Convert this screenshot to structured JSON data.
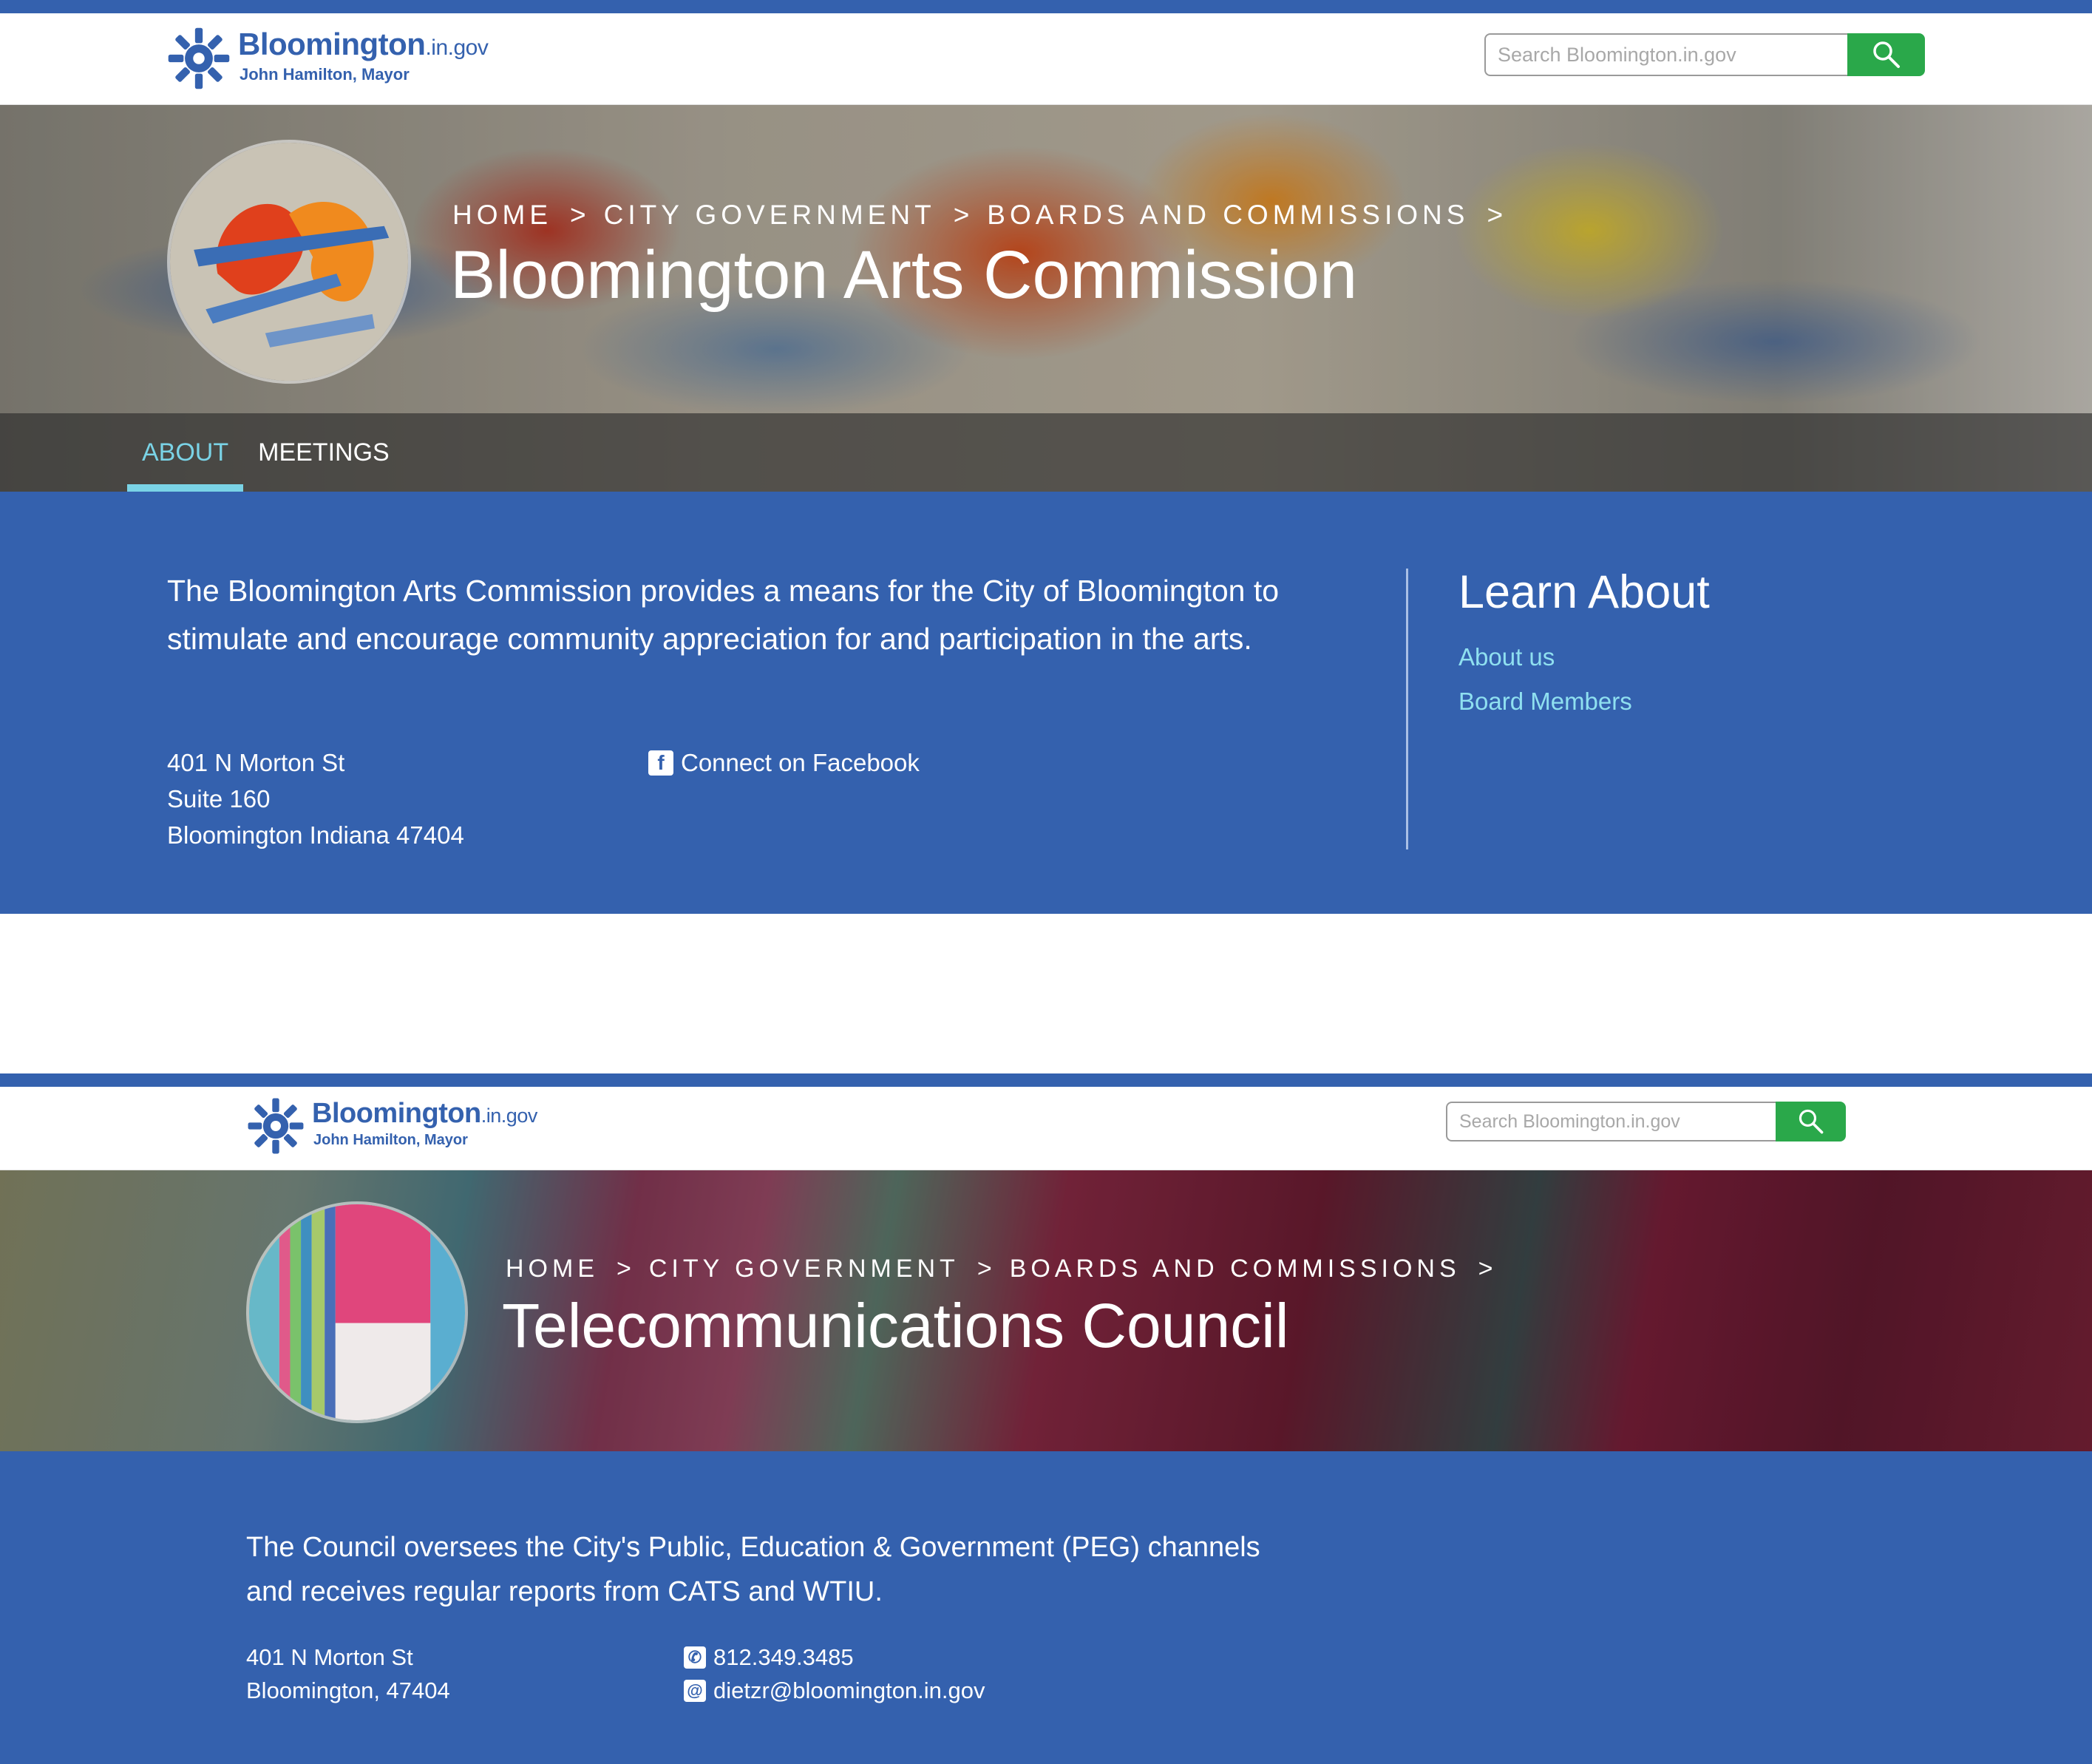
{
  "site": {
    "logo_name": "Bloomington",
    "logo_domain": ".in.gov",
    "mayor": "John Hamilton, Mayor",
    "search_placeholder": "Search Bloomington.in.gov",
    "brand_color": "#3461ae",
    "search_button_color": "#2aa84a"
  },
  "page1": {
    "breadcrumbs": [
      "HOME",
      "CITY GOVERNMENT",
      "BOARDS AND COMMISSIONS"
    ],
    "breadcrumb_separator": ">",
    "title": "Bloomington Arts Commission",
    "tabs": [
      {
        "label": "ABOUT",
        "active": true
      },
      {
        "label": "MEETINGS",
        "active": false
      }
    ],
    "description": "The Bloomington Arts Commission provides a means for the City of Bloomington to stimulate and encourage community appreciation for and participation in the arts.",
    "address": [
      "401 N Morton St",
      "Suite 160",
      "Bloomington Indiana 47404"
    ],
    "facebook_link": "Connect on Facebook",
    "learn_about": {
      "heading": "Learn About",
      "links": [
        "About us",
        "Board Members"
      ]
    }
  },
  "page2": {
    "breadcrumbs": [
      "HOME",
      "CITY GOVERNMENT",
      "BOARDS AND COMMISSIONS"
    ],
    "breadcrumb_separator": ">",
    "title": "Telecommunications Council",
    "description": "The Council oversees the City's Public, Education & Government (PEG) channels and receives regular reports from CATS and WTIU.",
    "address": [
      "401 N Morton St",
      "Bloomington, 47404"
    ],
    "phone": "812.349.3485",
    "email": "dietzr@bloomington.in.gov"
  }
}
